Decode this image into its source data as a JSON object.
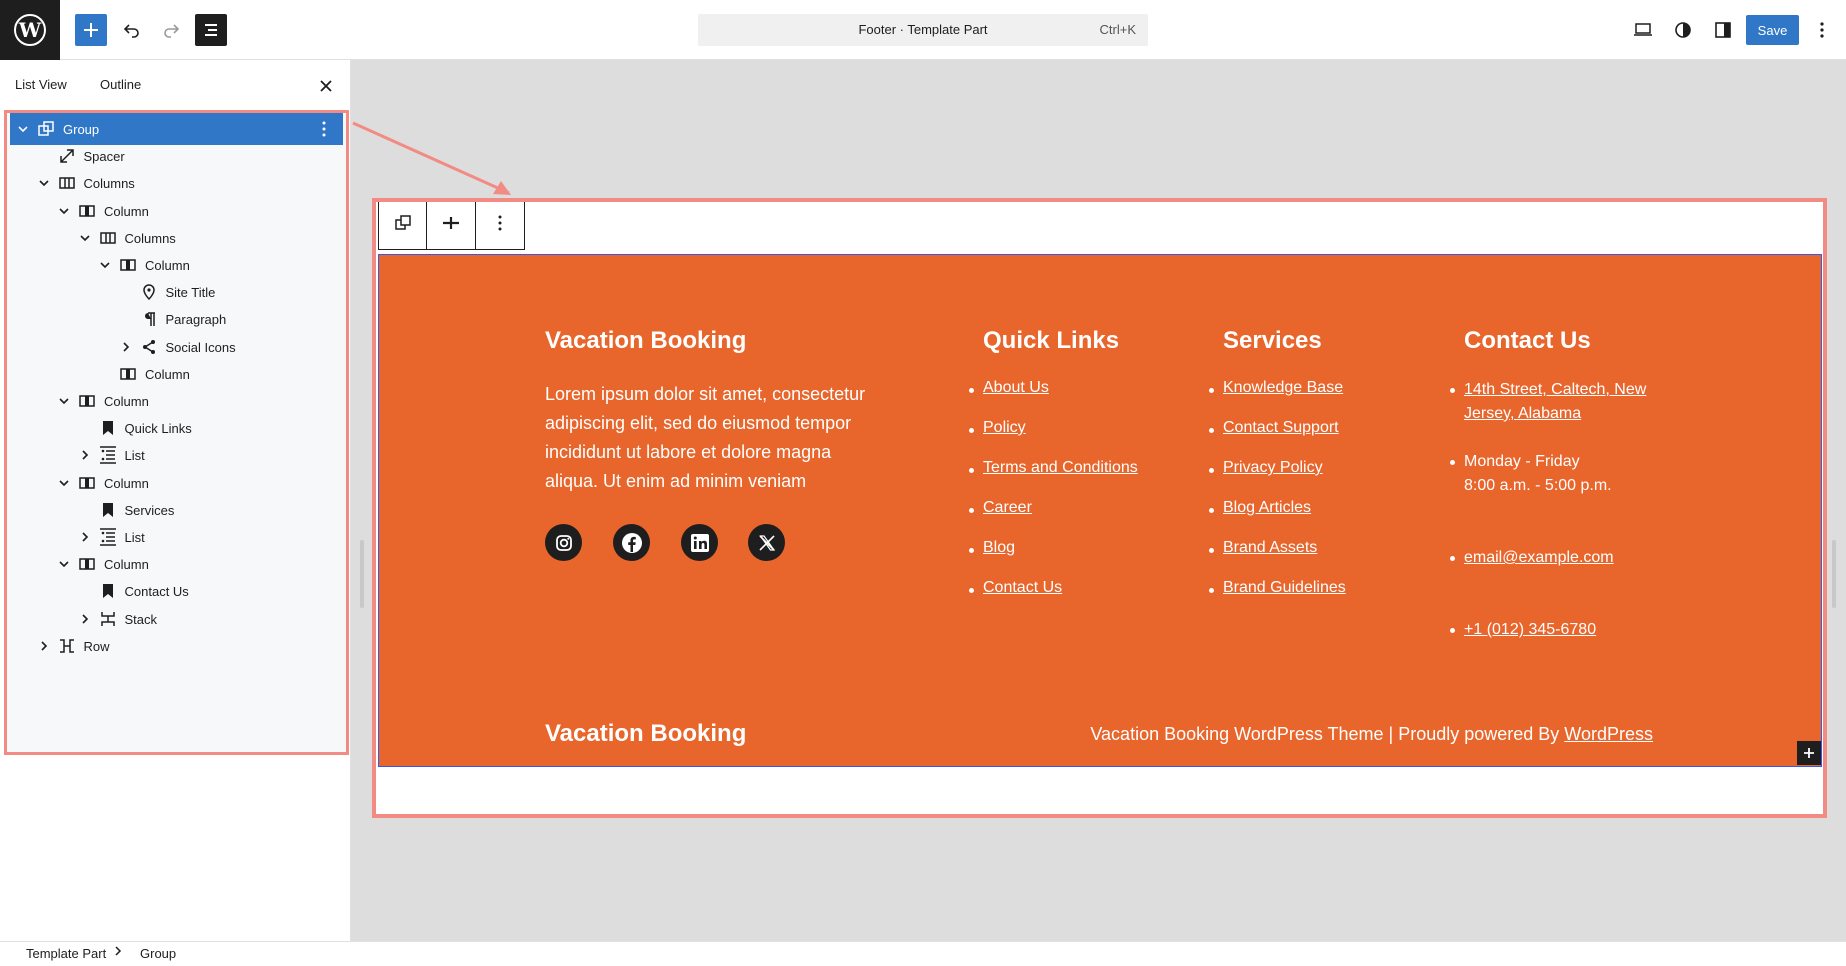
{
  "topbar": {
    "command_title": "Footer · Template Part",
    "command_shortcut": "Ctrl+K",
    "save_label": "Save"
  },
  "sidebar": {
    "tabs": [
      "List View",
      "Outline"
    ],
    "tree": [
      {
        "label": "Group",
        "icon": "group-icon",
        "depth": 0,
        "chevron": "down",
        "selected": true
      },
      {
        "label": "Spacer",
        "icon": "spacer-icon",
        "depth": 1,
        "chevron": ""
      },
      {
        "label": "Columns",
        "icon": "columns-icon",
        "depth": 1,
        "chevron": "down"
      },
      {
        "label": "Column",
        "icon": "column-icon",
        "depth": 2,
        "chevron": "down"
      },
      {
        "label": "Columns",
        "icon": "columns-icon",
        "depth": 3,
        "chevron": "down"
      },
      {
        "label": "Column",
        "icon": "column-icon",
        "depth": 4,
        "chevron": "down"
      },
      {
        "label": "Site Title",
        "icon": "site-title-icon",
        "depth": 5,
        "chevron": ""
      },
      {
        "label": "Paragraph",
        "icon": "paragraph-icon",
        "depth": 5,
        "chevron": ""
      },
      {
        "label": "Social Icons",
        "icon": "share-icon",
        "depth": 5,
        "chevron": "right"
      },
      {
        "label": "Column",
        "icon": "column-icon",
        "depth": 4,
        "chevron": ""
      },
      {
        "label": "Column",
        "icon": "column-icon",
        "depth": 2,
        "chevron": "down"
      },
      {
        "label": "Quick Links",
        "icon": "heading-bookmark-icon",
        "depth": 3,
        "chevron": ""
      },
      {
        "label": "List",
        "icon": "list-icon",
        "depth": 3,
        "chevron": "right"
      },
      {
        "label": "Column",
        "icon": "column-icon",
        "depth": 2,
        "chevron": "down"
      },
      {
        "label": "Services",
        "icon": "heading-bookmark-icon",
        "depth": 3,
        "chevron": ""
      },
      {
        "label": "List",
        "icon": "list-icon",
        "depth": 3,
        "chevron": "right"
      },
      {
        "label": "Column",
        "icon": "column-icon",
        "depth": 2,
        "chevron": "down"
      },
      {
        "label": "Contact Us",
        "icon": "heading-bookmark-icon",
        "depth": 3,
        "chevron": ""
      },
      {
        "label": "Stack",
        "icon": "stack-icon",
        "depth": 3,
        "chevron": "right"
      },
      {
        "label": "Row",
        "icon": "row-icon",
        "depth": 1,
        "chevron": "right"
      }
    ]
  },
  "footer": {
    "site_title": "Vacation Booking",
    "description": "Lorem ipsum dolor sit amet, consectetur adipiscing elit, sed do eiusmod tempor incididunt ut labore et dolore magna aliqua. Ut enim ad minim veniam",
    "social": [
      "instagram-icon",
      "facebook-icon",
      "linkedin-icon",
      "x-icon"
    ],
    "quick_links": {
      "heading": "Quick Links",
      "items": [
        "About Us",
        "Policy",
        "Terms and Conditions",
        "Career",
        "Blog",
        "Contact Us"
      ]
    },
    "services": {
      "heading": "Services",
      "items": [
        "Knowledge Base",
        "Contact Support",
        "Privacy Policy",
        "Blog Articles",
        "Brand Assets",
        "Brand Guidelines"
      ]
    },
    "contact": {
      "heading": "Contact Us",
      "address_line1": "14th Street, Caltech, New",
      "address_line2": "Jersey, Alabama",
      "hours_line1": "Monday - Friday",
      "hours_line2": "8:00 a.m. - 5:00 p.m.",
      "email": "email@example.com",
      "phone": "+1 (012) 345-6780"
    },
    "bottom_title": "Vacation Booking",
    "credits_text": "Vacation Booking WordPress Theme | Proudly powered By ",
    "credits_link": "WordPress",
    "background_color": "#e8652b"
  },
  "breadcrumb": [
    "Template Part",
    "Group"
  ],
  "colors": {
    "accent": "#3177c7",
    "highlight": "#f28b84"
  }
}
